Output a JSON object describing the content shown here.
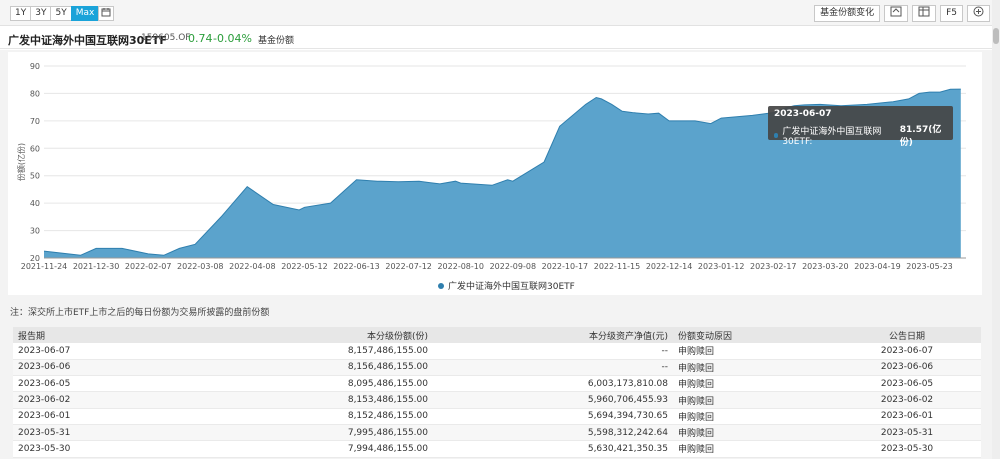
{
  "toolbar": {
    "ranges": [
      "1Y",
      "3Y",
      "5Y",
      "Max"
    ],
    "active_range": "Max",
    "calendar_icon": "calendar-icon",
    "right_buttons": [
      "基金份额变化",
      "F5"
    ],
    "export_icon": "export-icon",
    "table_icon": "table-icon",
    "add_icon": "plus-circle-icon"
  },
  "fund": {
    "name": "广发中证海外中国互联网30ETF",
    "code": "159605.OF",
    "price": "0.74",
    "change": "-0.04%",
    "tag": "基金份额"
  },
  "chart_data": {
    "type": "area",
    "ylabel": "份额(亿份)",
    "ylim": [
      20,
      90
    ],
    "yticks": [
      20,
      30,
      40,
      50,
      60,
      70,
      80,
      90
    ],
    "xticks": [
      "2021-11-24",
      "2021-12-30",
      "2022-02-07",
      "2022-03-08",
      "2022-04-08",
      "2022-05-12",
      "2022-06-13",
      "2022-07-12",
      "2022-08-10",
      "2022-09-08",
      "2022-10-17",
      "2022-11-15",
      "2022-12-14",
      "2023-01-12",
      "2023-02-17",
      "2023-03-20",
      "2023-04-19",
      "2023-05-23"
    ],
    "grid": true,
    "colors": {
      "fill": "#5ba3cc",
      "line": "#2f7fae"
    },
    "series": [
      {
        "name": "广发中证海外中国互联网30ETF",
        "x": [
          0,
          0.7,
          1.0,
          1.5,
          2.0,
          2.3,
          2.6,
          2.9,
          3.4,
          3.9,
          4.4,
          4.9,
          5.0,
          5.5,
          6.0,
          6.4,
          6.8,
          7.2,
          7.4,
          7.6,
          7.9,
          8.0,
          8.6,
          8.9,
          9.0,
          9.6,
          9.9,
          10.4,
          10.6,
          10.7,
          10.9,
          11.1,
          11.3,
          11.6,
          11.8,
          12.0,
          12.5,
          12.8,
          13.0,
          13.3,
          13.6,
          14.0,
          14.2,
          14.4,
          14.6,
          14.9,
          15.3,
          15.8,
          16.3,
          16.6,
          16.8,
          17.0,
          17.2,
          17.4,
          17.6
        ],
        "values": [
          22.5,
          21.0,
          23.5,
          23.5,
          21.5,
          21.0,
          23.5,
          25.0,
          35.0,
          46.0,
          39.5,
          37.5,
          38.5,
          40.0,
          48.5,
          48.0,
          47.8,
          48.0,
          47.5,
          47.0,
          48.0,
          47.3,
          46.5,
          48.5,
          48.0,
          55.0,
          68.0,
          76.0,
          78.5,
          78.0,
          76.0,
          73.5,
          73.0,
          72.5,
          72.8,
          70.0,
          70.0,
          69.0,
          71.0,
          71.5,
          72.0,
          73.0,
          74.5,
          75.5,
          75.8,
          76.0,
          75.5,
          76.0,
          77.0,
          78.0,
          80.0,
          80.5,
          80.5,
          81.5,
          81.57
        ]
      }
    ],
    "tooltip": {
      "date": "2023-06-07",
      "label": "广发中证海外中国互联网30ETF:",
      "value": "81.57(亿份)"
    }
  },
  "note": "注：深交所上市ETF上市之后的每日份额为交易所披露的盘前份额",
  "table": {
    "headers": [
      "报告期",
      "本分级份额(份)",
      "本分级资产净值(元)",
      "份额变动原因",
      "公告日期"
    ],
    "rows": [
      [
        "2023-06-07",
        "8,157,486,155.00",
        "--",
        "申购赎回",
        "2023-06-07"
      ],
      [
        "2023-06-06",
        "8,156,486,155.00",
        "--",
        "申购赎回",
        "2023-06-06"
      ],
      [
        "2023-06-05",
        "8,095,486,155.00",
        "6,003,173,810.08",
        "申购赎回",
        "2023-06-05"
      ],
      [
        "2023-06-02",
        "8,153,486,155.00",
        "5,960,706,455.93",
        "申购赎回",
        "2023-06-02"
      ],
      [
        "2023-06-01",
        "8,152,486,155.00",
        "5,694,394,730.65",
        "申购赎回",
        "2023-06-01"
      ],
      [
        "2023-05-31",
        "7,995,486,155.00",
        "5,598,312,242.64",
        "申购赎回",
        "2023-05-31"
      ],
      [
        "2023-05-30",
        "7,994,486,155.00",
        "5,630,421,350.35",
        "申购赎回",
        "2023-05-30"
      ]
    ]
  }
}
